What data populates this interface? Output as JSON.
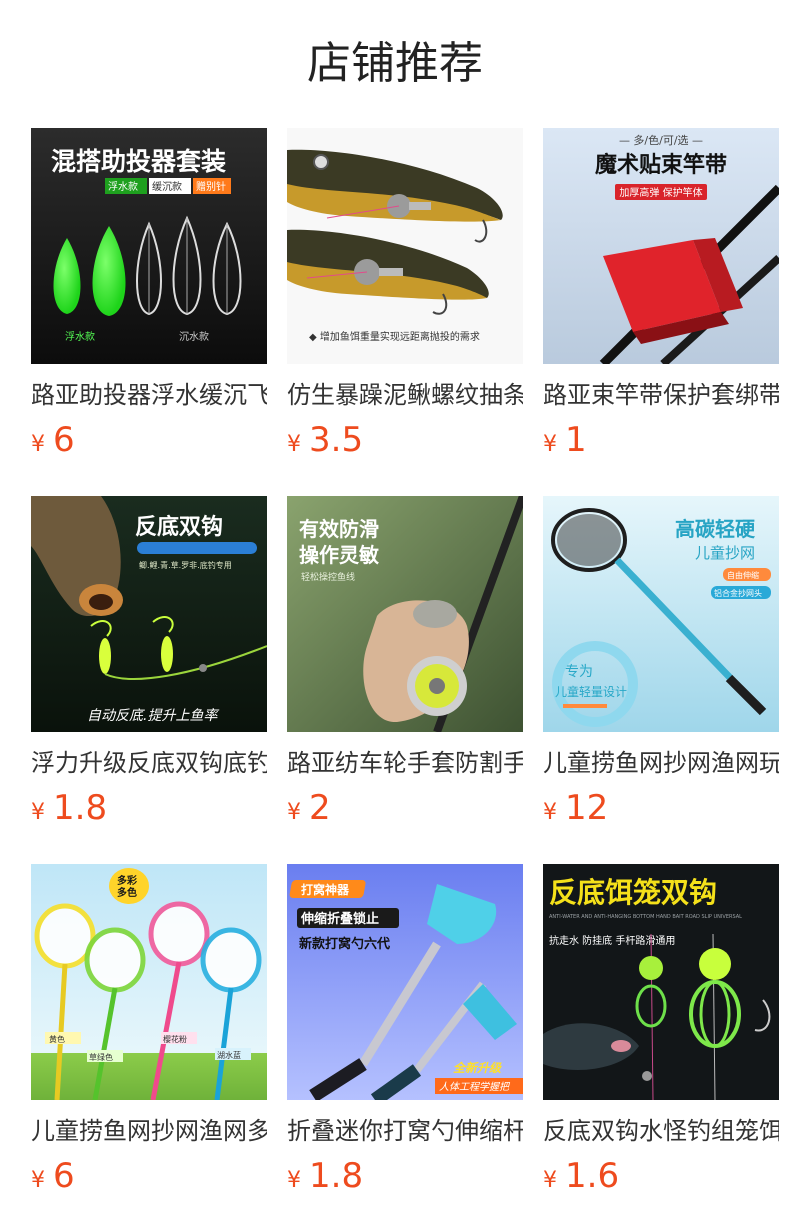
{
  "header": {
    "title": "店铺推荐"
  },
  "products": [
    {
      "name": "路亚助投器浮水缓沉飞铅套装",
      "currency": "¥",
      "price": "6",
      "banner": {
        "headline": "混搭助投器套装",
        "tags": [
          "浮水款",
          "缓沉款",
          "赠别针"
        ],
        "label_left": "浮水款",
        "label_right": "沉水款"
      }
    },
    {
      "name": "仿生暴躁泥鳅螺纹抽条软饵",
      "currency": "¥",
      "price": "3.5",
      "banner": {
        "caption": "◆ 增加鱼饵重量实现远距离抛投的需求"
      }
    },
    {
      "name": "路亚束竿带保护套绑带",
      "currency": "¥",
      "price": "1",
      "banner": {
        "top": "— 多/色/可/选 —",
        "headline": "魔术贴束竿带",
        "tag": "加厚高弹 保护竿体"
      }
    },
    {
      "name": "浮力升级反底双钩底钓组",
      "currency": "¥",
      "price": "1.8",
      "banner": {
        "headline": "反底双钩",
        "sub": "鲫.鲤.青.草.罗非.底钓专用",
        "bottom": "自动反底.提升上鱼率"
      }
    },
    {
      "name": "路亚纺车轮手套防割手指套",
      "currency": "¥",
      "price": "2",
      "banner": {
        "headline1": "有效防滑",
        "headline2": "操作灵敏",
        "sub": "轻松操控鱼线"
      }
    },
    {
      "name": "儿童捞鱼网抄网渔网玩具",
      "currency": "¥",
      "price": "12",
      "banner": {
        "headline1": "高碳轻硬",
        "headline2": "儿童抄网",
        "tag1": "自由伸缩",
        "tag2": "铝合金抄网头",
        "ring1": "专为",
        "ring2": "儿童轻量设计"
      }
    },
    {
      "name": "儿童捞鱼网抄网渔网多彩多色",
      "currency": "¥",
      "price": "6",
      "banner": {
        "bubble1": "多彩",
        "bubble2": "多色",
        "labels": [
          "黄色",
          "草绿色",
          "樱花粉",
          "湖水蓝"
        ]
      }
    },
    {
      "name": "折叠迷你打窝勺伸缩杆",
      "currency": "¥",
      "price": "1.8",
      "banner": {
        "tag": "打窝神器",
        "l1": "伸缩折叠锁止",
        "l2": "新款打窝勺六代",
        "r1": "全新升级",
        "r2": "人体工程学握把"
      }
    },
    {
      "name": "反底双钩水怪钓组笼饵",
      "currency": "¥",
      "price": "1.6",
      "banner": {
        "headline": "反底饵笼双钩",
        "en": "ANTI-WATER AND ANTI-HANGING BOTTOM HAND BAIT ROAD SLIP UNIVERSAL",
        "sub": "抗走水 防挂底 手杆路滑通用"
      }
    }
  ],
  "colors": {
    "price": "#ee4b1e",
    "title": "#222222",
    "name": "#333333"
  }
}
